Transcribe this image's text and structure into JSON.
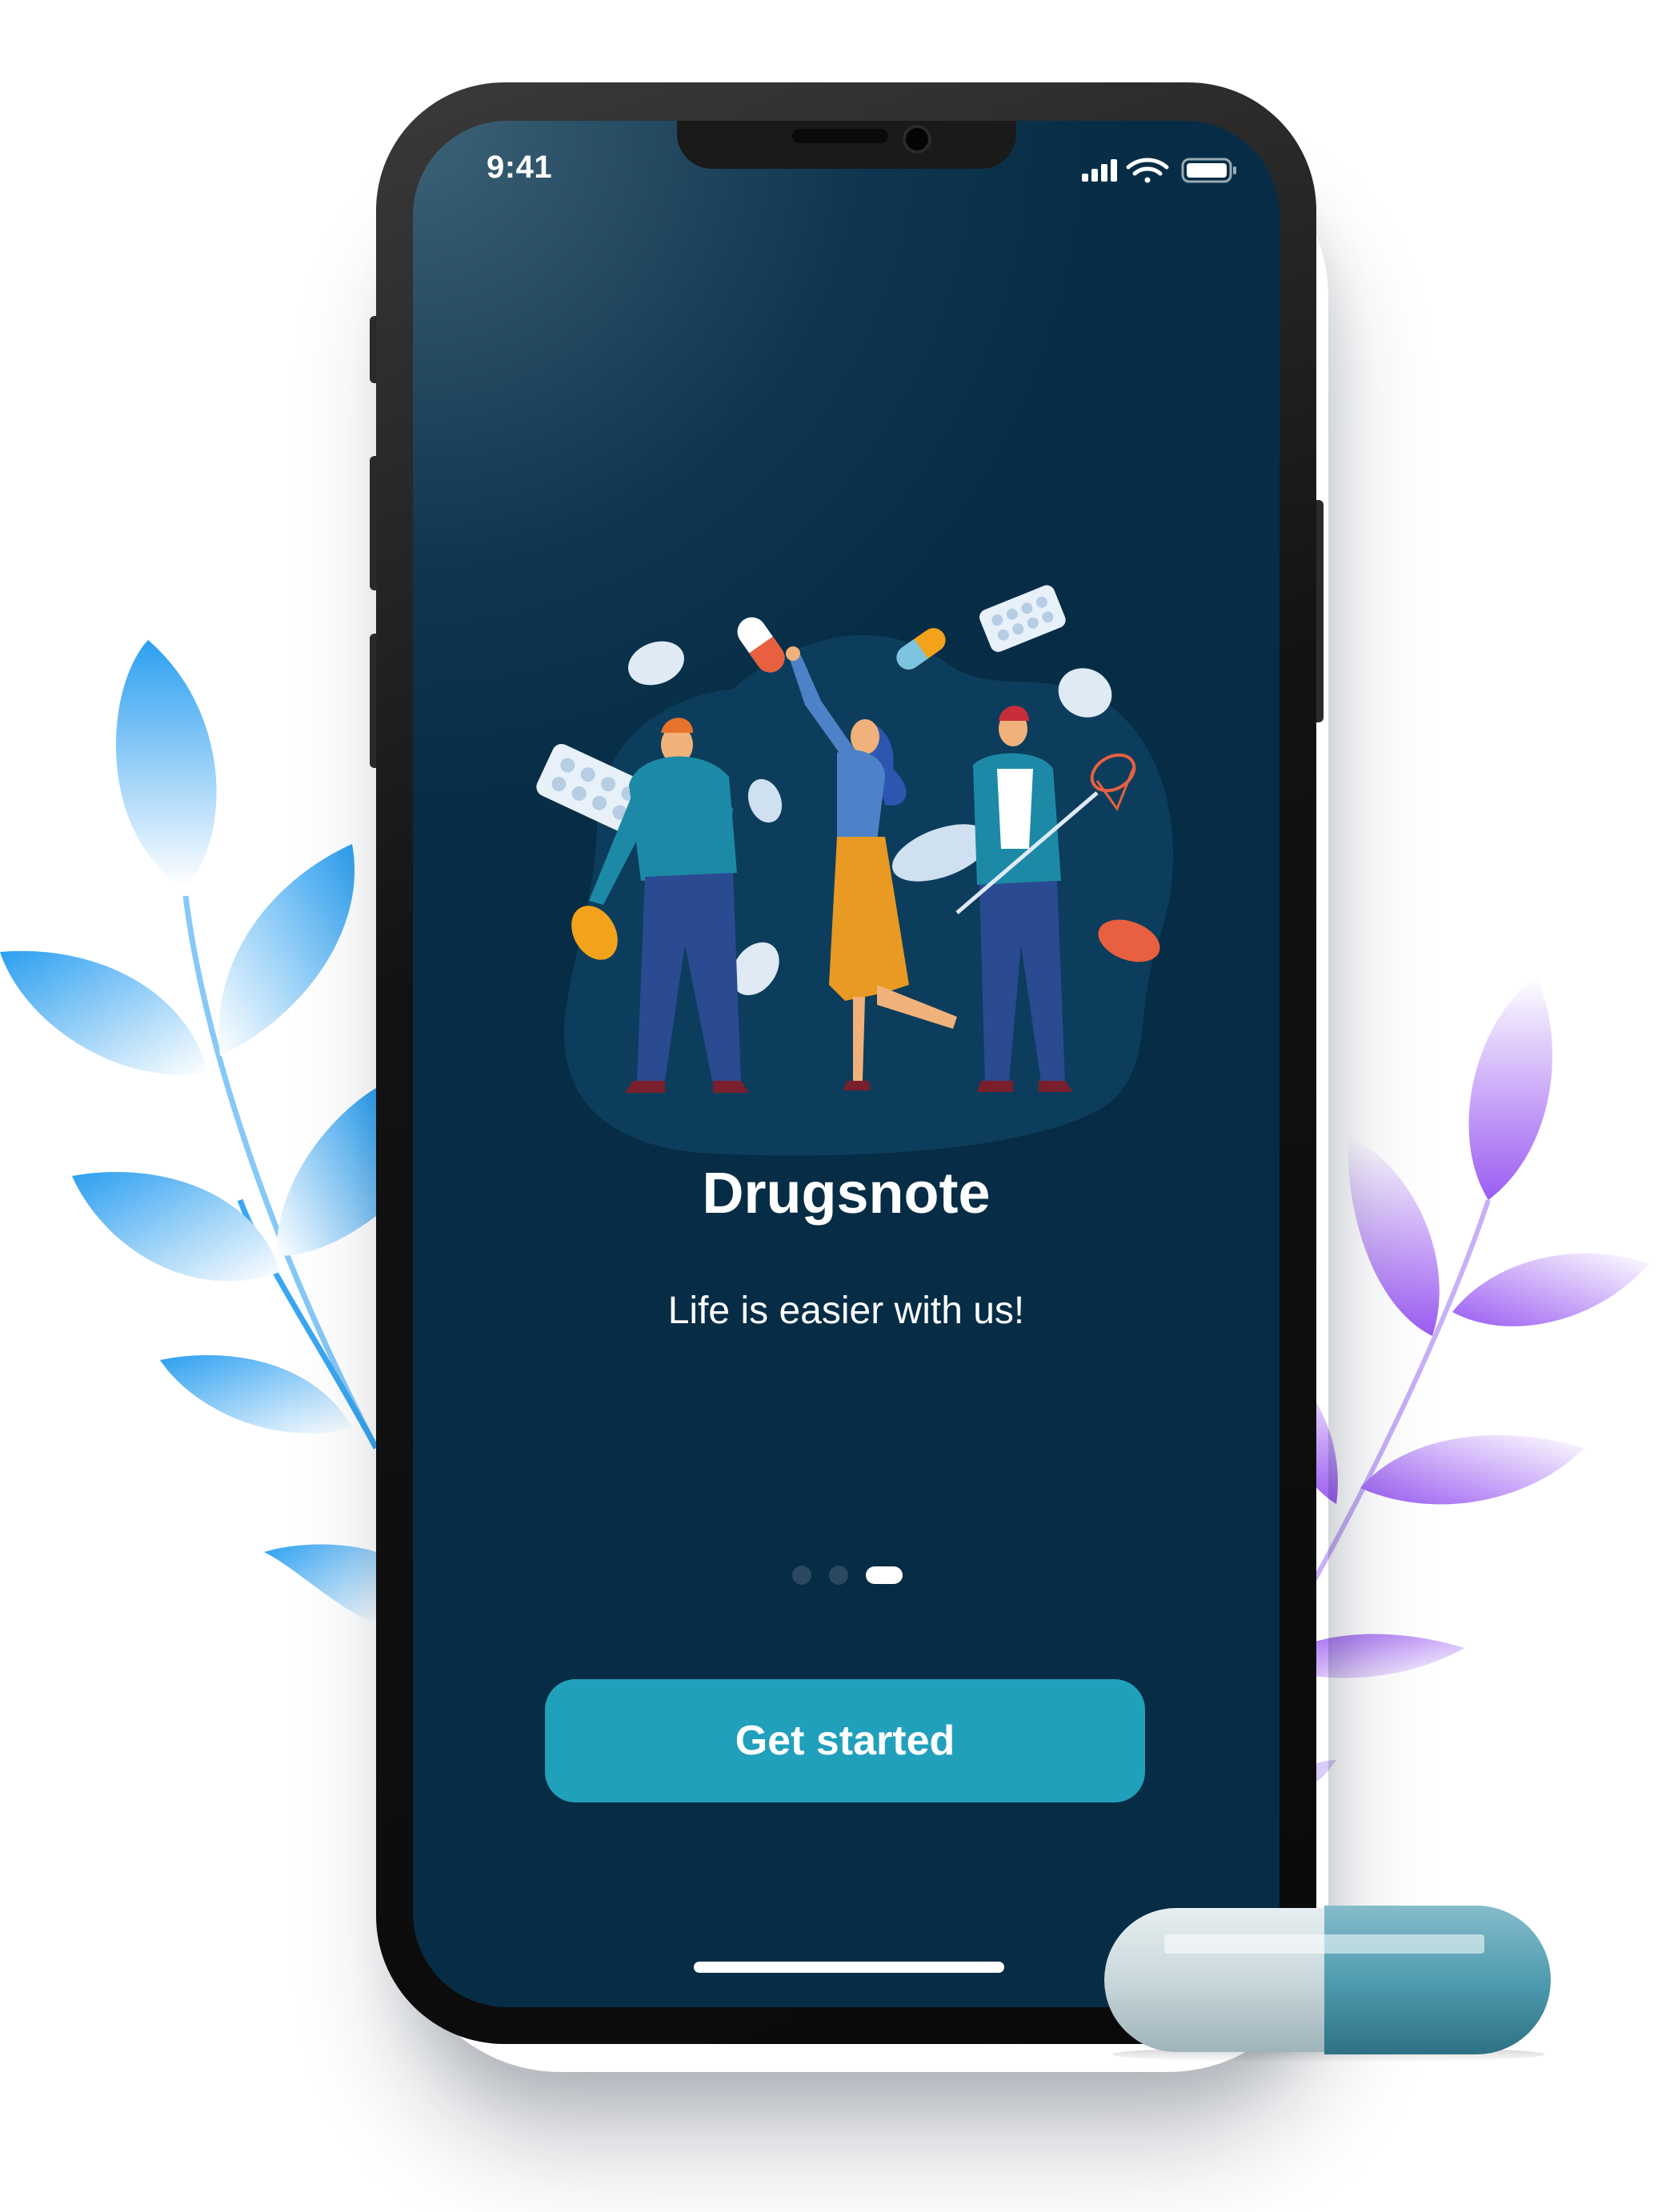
{
  "status_bar": {
    "time": "9:41",
    "icons": [
      "cellular-signal-icon",
      "wifi-icon",
      "battery-icon"
    ]
  },
  "onboarding": {
    "title": "Drugsnote",
    "subtitle": "Life is easier with us!",
    "page_indicator": {
      "total": 3,
      "active_index": 2
    },
    "cta_label": "Get started"
  },
  "colors": {
    "screen_background": "#062d45",
    "accent_button": "#21a0bc",
    "text_primary": "#ffffff",
    "dot_inactive": "#2a4860",
    "dot_active": "#ffffff",
    "leaf_blue": "#2aa0ef",
    "leaf_purple": "#9a5ef0",
    "capsule_teal": "#4f9cb0"
  }
}
